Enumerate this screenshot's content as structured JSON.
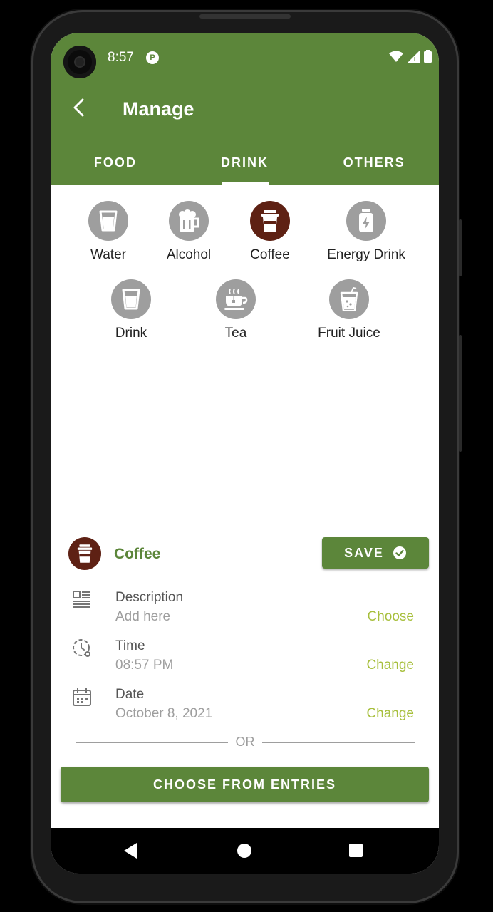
{
  "status": {
    "time": "8:57",
    "badge": "P"
  },
  "header": {
    "title": "Manage"
  },
  "tabs": [
    {
      "label": "FOOD",
      "active": false
    },
    {
      "label": "DRINK",
      "active": true
    },
    {
      "label": "OTHERS",
      "active": false
    }
  ],
  "drinks": {
    "row1": [
      {
        "label": "Water",
        "icon": "water-glass-icon"
      },
      {
        "label": "Alcohol",
        "icon": "beer-mug-icon"
      },
      {
        "label": "Coffee",
        "icon": "coffee-cup-icon",
        "selected": true
      },
      {
        "label": "Energy Drink",
        "icon": "energy-can-icon"
      }
    ],
    "row2": [
      {
        "label": "Drink",
        "icon": "drink-glass-icon"
      },
      {
        "label": "Tea",
        "icon": "tea-cup-icon"
      },
      {
        "label": "Fruit Juice",
        "icon": "juice-glass-icon"
      }
    ]
  },
  "selection": {
    "name": "Coffee",
    "save_label": "SAVE"
  },
  "fields": {
    "description": {
      "label": "Description",
      "value": "Add here",
      "action": "Choose"
    },
    "time": {
      "label": "Time",
      "value": "08:57 PM",
      "action": "Change"
    },
    "date": {
      "label": "Date",
      "value": "October 8, 2021",
      "action": "Change"
    }
  },
  "divider_text": "OR",
  "choose_entries_label": "CHOOSE FROM ENTRIES",
  "colors": {
    "primary": "#5c863a",
    "selected_icon_bg": "#5e2114",
    "unselected_icon_bg": "#9e9e9e",
    "action_text": "#a7bf3c"
  }
}
